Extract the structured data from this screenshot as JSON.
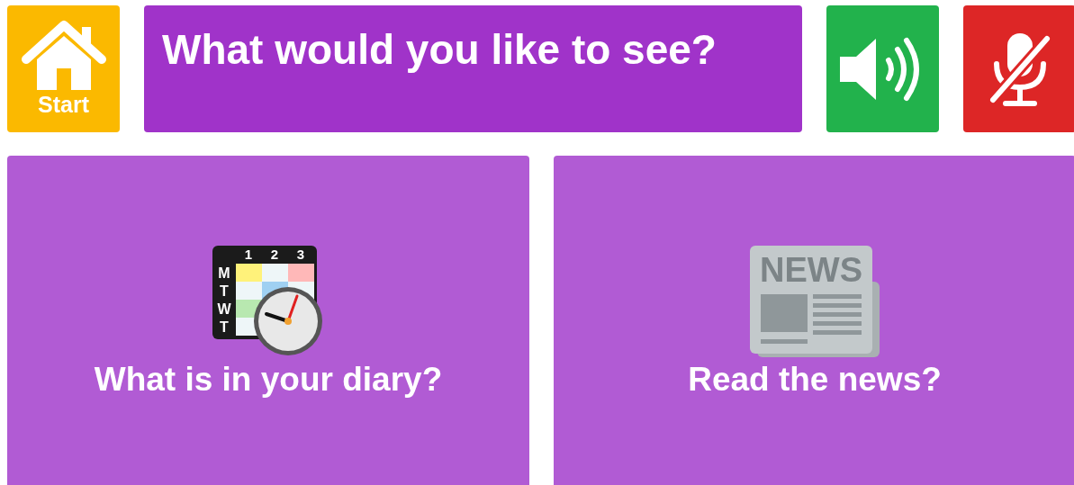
{
  "home": {
    "label": "Start"
  },
  "prompt": "What would you like to see?",
  "speaker": {
    "on": true
  },
  "microphone": {
    "muted": true
  },
  "cards": [
    {
      "kind": "diary",
      "label": "What is in your diary?",
      "icon_text": [
        "1",
        "2",
        "3",
        "M",
        "T",
        "W",
        "T"
      ]
    },
    {
      "kind": "news",
      "label": "Read the news?",
      "icon_text": [
        "NEWS"
      ]
    }
  ]
}
